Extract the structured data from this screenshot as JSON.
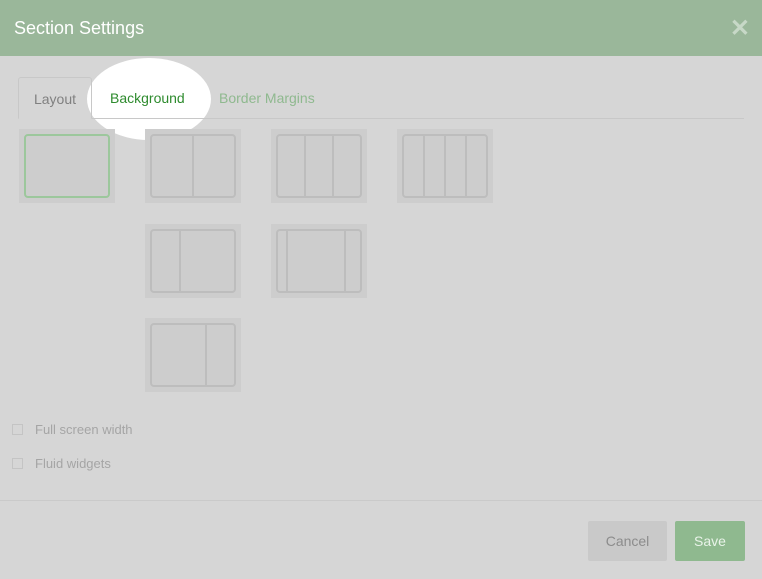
{
  "dialog": {
    "title": "Section Settings"
  },
  "tabs": [
    {
      "label": "Layout"
    },
    {
      "label": "Background"
    },
    {
      "label": "Border Margins"
    }
  ],
  "options": [
    {
      "label": "Full screen width",
      "checked": false
    },
    {
      "label": "Fluid widgets",
      "checked": false
    }
  ],
  "footer": {
    "cancel_label": "Cancel",
    "save_label": "Save"
  },
  "colors": {
    "header": "#9ab79a",
    "accent": "#2e8b2e",
    "save_button": "#8fb98f",
    "overlay": "#d6d6d6"
  }
}
